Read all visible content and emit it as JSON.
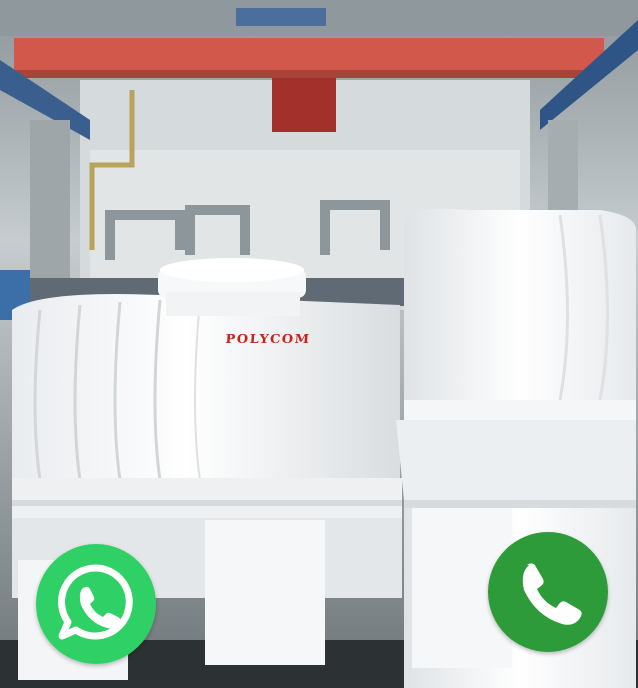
{
  "product_image": {
    "brand_text": "POLYCOM"
  },
  "actions": {
    "whatsapp": {
      "icon": "whatsapp-icon",
      "color": "#2fd065"
    },
    "call": {
      "icon": "phone-icon",
      "color": "#2e9b3a"
    }
  }
}
